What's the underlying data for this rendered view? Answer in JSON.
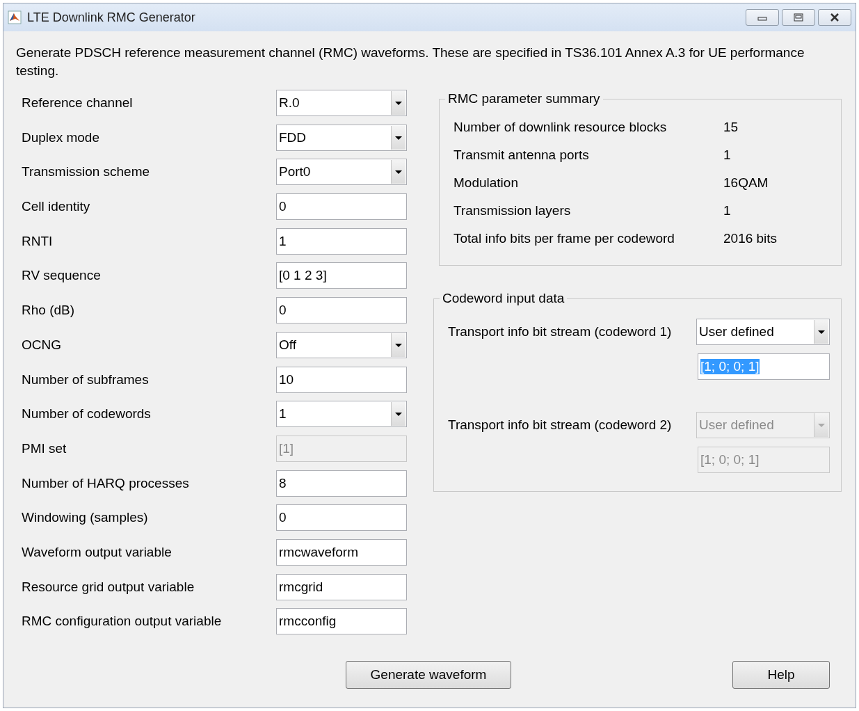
{
  "window": {
    "title": "LTE Downlink RMC Generator"
  },
  "description": "Generate PDSCH reference measurement channel (RMC) waveforms. These are specified in TS36.101 Annex A.3 for UE performance testing.",
  "parameters": [
    {
      "label": "Reference channel",
      "kind": "dropdown",
      "value": "R.0",
      "disabled": false
    },
    {
      "label": "Duplex mode",
      "kind": "dropdown",
      "value": "FDD",
      "disabled": false
    },
    {
      "label": "Transmission scheme",
      "kind": "dropdown",
      "value": "Port0",
      "disabled": false
    },
    {
      "label": "Cell identity",
      "kind": "edit",
      "value": "0",
      "disabled": false
    },
    {
      "label": "RNTI",
      "kind": "edit",
      "value": "1",
      "disabled": false
    },
    {
      "label": "RV sequence",
      "kind": "edit",
      "value": "[0 1 2 3]",
      "disabled": false
    },
    {
      "label": "Rho (dB)",
      "kind": "edit",
      "value": "0",
      "disabled": false
    },
    {
      "label": "OCNG",
      "kind": "dropdown",
      "value": "Off",
      "disabled": false
    },
    {
      "label": "Number of subframes",
      "kind": "edit",
      "value": "10",
      "disabled": false
    },
    {
      "label": "Number of codewords",
      "kind": "dropdown",
      "value": "1",
      "disabled": false
    },
    {
      "label": "PMI set",
      "kind": "edit",
      "value": "[1]",
      "disabled": true
    },
    {
      "label": "Number of HARQ processes",
      "kind": "edit",
      "value": "8",
      "disabled": false
    },
    {
      "label": "Windowing (samples)",
      "kind": "edit",
      "value": "0",
      "disabled": false
    },
    {
      "label": "Waveform output variable",
      "kind": "edit",
      "value": "rmcwaveform",
      "disabled": false
    },
    {
      "label": "Resource grid output variable",
      "kind": "edit",
      "value": "rmcgrid",
      "disabled": false
    },
    {
      "label": "RMC configuration output variable",
      "kind": "edit",
      "value": "rmcconfig",
      "disabled": false
    }
  ],
  "summary": {
    "title": "RMC parameter summary",
    "rows": [
      {
        "label": "Number of downlink resource blocks",
        "value": "15"
      },
      {
        "label": "Transmit antenna ports",
        "value": "1"
      },
      {
        "label": "Modulation",
        "value": "16QAM"
      },
      {
        "label": "Transmission layers",
        "value": "1"
      },
      {
        "label": "Total info bits per frame per codeword",
        "value": "2016 bits"
      }
    ]
  },
  "codeword_input": {
    "title": "Codeword input data",
    "streams": [
      {
        "label": "Transport info bit stream (codeword 1)",
        "source": "User defined",
        "value": "[1; 0; 0; 1]",
        "disabled": false,
        "text_selected": true
      },
      {
        "label": "Transport info bit stream (codeword 2)",
        "source": "User defined",
        "value": "[1; 0; 0; 1]",
        "disabled": true,
        "text_selected": false
      }
    ]
  },
  "buttons": [
    {
      "label": "Generate waveform"
    },
    {
      "label": "Help"
    }
  ]
}
